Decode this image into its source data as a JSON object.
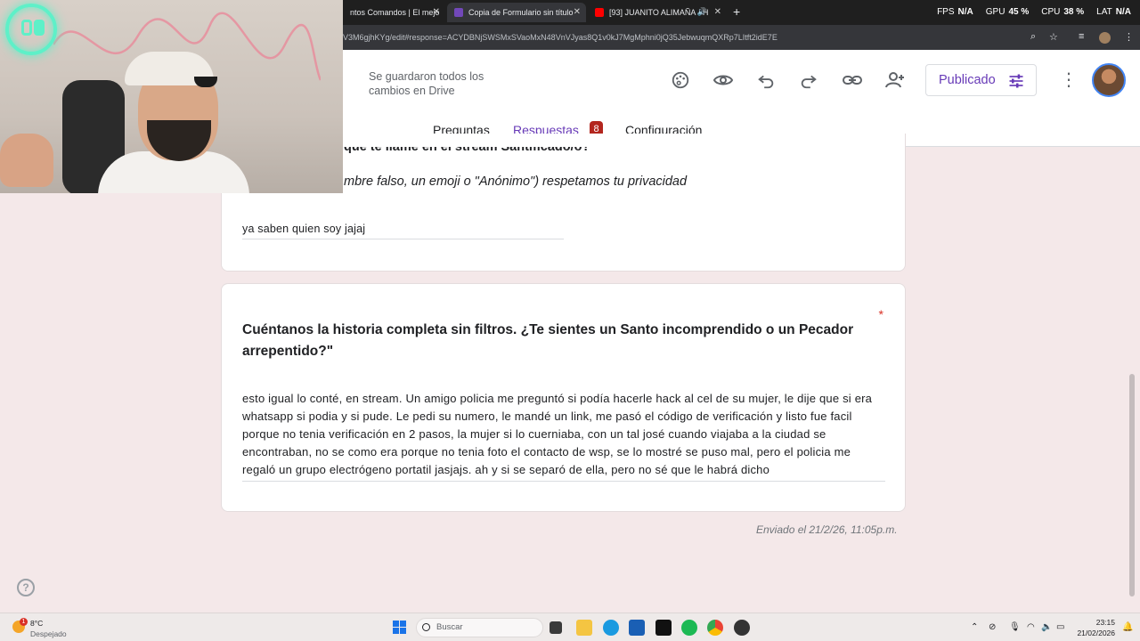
{
  "browser": {
    "tabs": [
      {
        "label": "ntos Comandos | El mejo",
        "icon": "page-icon",
        "color": "#e8eaed"
      },
      {
        "label": "Copia de Formulario sin título",
        "icon": "forms-icon",
        "color": "#7248b9"
      },
      {
        "label": "[93] JUANITO ALIMAÑA - H",
        "icon": "youtube-icon",
        "color": "#ff0000"
      }
    ],
    "url": "V3M6gjhKYg/edit#response=ACYDBNjSWSMxSVaoMxN48VnVJyas8Q1v0kJ7MgMphni0jQ35JebwuqmQXRp7LItft2idE7E",
    "stats": [
      {
        "label": "FPS",
        "value": "N/A"
      },
      {
        "label": "GPU",
        "value": "45 %"
      },
      {
        "label": "CPU",
        "value": "38 %"
      },
      {
        "label": "LAT",
        "value": "N/A"
      }
    ]
  },
  "header": {
    "save_status": "Se guardaron todos los cambios en Drive",
    "publish_label": "Publicado",
    "tabs": {
      "preguntas": "Preguntas",
      "respuestas": "Respuestas",
      "configuracion": "Configuración"
    },
    "responses_count": "8",
    "accent": "#673ab7"
  },
  "question1": {
    "title": "que te llame en el stream Santificado/o?",
    "description": "mbre falso, un emoji o \"Anónimo\") respetamos tu privacidad",
    "answer": "ya saben quien soy jajaj"
  },
  "question2": {
    "required_mark": "*",
    "title": "Cuéntanos la historia completa sin filtros. ¿Te sientes un Santo incomprendido o un Pecador arrepentido?\"",
    "answer": "esto igual lo conté, en stream. Un amigo policia me preguntó si podía hacerle hack al cel de su mujer, le dije que si era whatsapp si podia y si pude. Le pedi su numero, le mandé un link, me pasó el código de verificación y listo fue facil porque no tenia verificación en 2 pasos, la mujer si lo cuerniaba, con un tal josé cuando viajaba a la ciudad se encontraban, no se como era porque no tenia foto el contacto de wsp, se lo mostré se puso mal, pero el policia me regaló un grupo electrógeno portatil jasjajs. ah y si se separó de ella, pero no sé que le habrá dicho"
  },
  "submitted": "Enviado el 21/2/26, 11:05p.m.",
  "help_glyph": "?",
  "taskbar": {
    "weather_temp": "8°C",
    "weather_desc": "Despejado",
    "weather_badge": "1",
    "search_placeholder": "Buscar",
    "time": "23:15",
    "date": "21/02/2026"
  }
}
